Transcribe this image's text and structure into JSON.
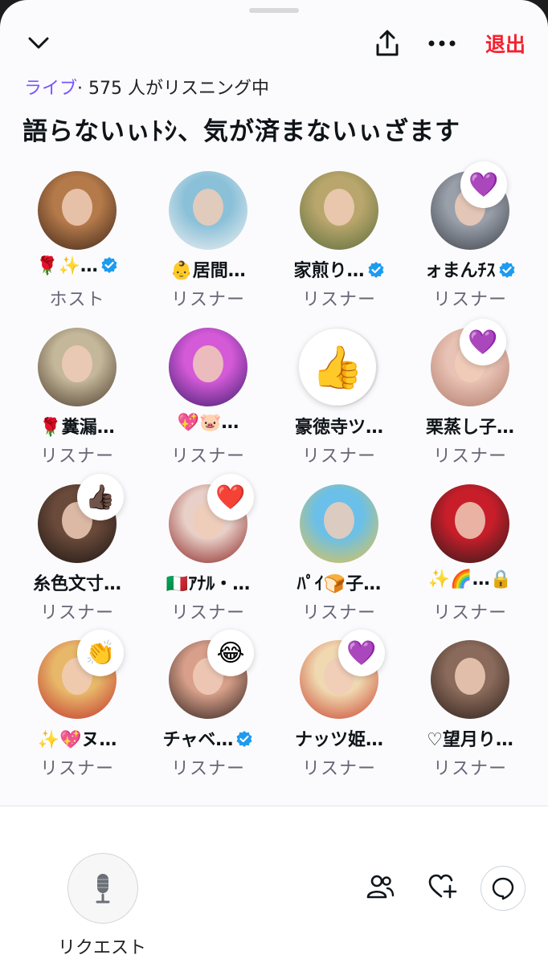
{
  "header": {
    "leave_label": "退出",
    "live_label": "ライブ",
    "listening_text": "· 575 人がリスニング中",
    "title": "語らないぃﾄｼ、気が済まないぃざます"
  },
  "participants": [
    {
      "name": "🌹✨…",
      "verified": true,
      "role": "ホスト",
      "reaction": "",
      "bg": "#b57a4a",
      "bg2": "#3b2418"
    },
    {
      "name": "👶居間…",
      "verified": false,
      "role": "リスナー",
      "reaction": "",
      "bg": "#8ac0d8",
      "bg2": "#f2f2f2"
    },
    {
      "name": "家煎り…",
      "verified": true,
      "role": "リスナー",
      "reaction": "",
      "bg": "#b8a66c",
      "bg2": "#5a6b3a"
    },
    {
      "name": "ォまんﾁｽ",
      "verified": true,
      "role": "リスナー",
      "reaction": "💜",
      "bg": "#9aa0aa",
      "bg2": "#3a3e46"
    },
    {
      "name": "🌹糞漏…",
      "verified": false,
      "role": "リスナー",
      "reaction": "",
      "bg": "#c4b79a",
      "bg2": "#4a3b2a"
    },
    {
      "name": "💖🐷…",
      "verified": false,
      "role": "リスナー",
      "reaction": "",
      "bg": "#d45ad8",
      "bg2": "#3a1c6a"
    },
    {
      "name": "豪徳寺ツ…",
      "verified": false,
      "role": "リスナー",
      "reaction": "👍",
      "bg": "#f3f3f5",
      "bg2": "#e5e5e8"
    },
    {
      "name": "栗蒸し子…",
      "verified": false,
      "role": "リスナー",
      "reaction": "💜",
      "bg": "#e8c2b4",
      "bg2": "#b07a6a"
    },
    {
      "name": "糸色文寸…",
      "verified": false,
      "role": "リスナー",
      "reaction": "👍🏿",
      "bg": "#6a4a3a",
      "bg2": "#1a1412"
    },
    {
      "name": "🇮🇹ｱﾅﾙ・…",
      "verified": false,
      "role": "リスナー",
      "reaction": "❤️",
      "bg": "#e8d0c8",
      "bg2": "#8a2020"
    },
    {
      "name": "ﾊﾟｲ🍞子…",
      "verified": false,
      "role": "リスナー",
      "reaction": "",
      "bg": "#6ac0e8",
      "bg2": "#e8c24a"
    },
    {
      "name": "✨🌈…🔒",
      "verified": false,
      "role": "リスナー",
      "reaction": "",
      "bg": "#c81e2a",
      "bg2": "#2a1a1a"
    },
    {
      "name": "✨💖ヌ…",
      "verified": false,
      "role": "リスナー",
      "reaction": "👏",
      "bg": "#e8b86a",
      "bg2": "#c0302a"
    },
    {
      "name": "チャベ…",
      "verified": true,
      "role": "リスナー",
      "reaction": "😂",
      "bg": "#d8a08a",
      "bg2": "#2a1c18"
    },
    {
      "name": "ナッツ姫…",
      "verified": false,
      "role": "リスナー",
      "reaction": "💜",
      "bg": "#f0d8b0",
      "bg2": "#c8402a"
    },
    {
      "name": "♡望月り…",
      "verified": false,
      "role": "リスナー",
      "reaction": "",
      "bg": "#8a6a5a",
      "bg2": "#2a1e1a"
    }
  ],
  "footer": {
    "request_label": "リクエスト"
  },
  "colors": {
    "accent": "#7856ff",
    "leave": "#f4212e",
    "verified": "#1d9bf0",
    "react_heart": "#9b7ef0"
  },
  "icons": [
    "chevron-down-icon",
    "share-icon",
    "more-icon",
    "mic-icon",
    "people-icon",
    "heart-plus-icon",
    "chat-icon",
    "verified-badge-icon"
  ]
}
